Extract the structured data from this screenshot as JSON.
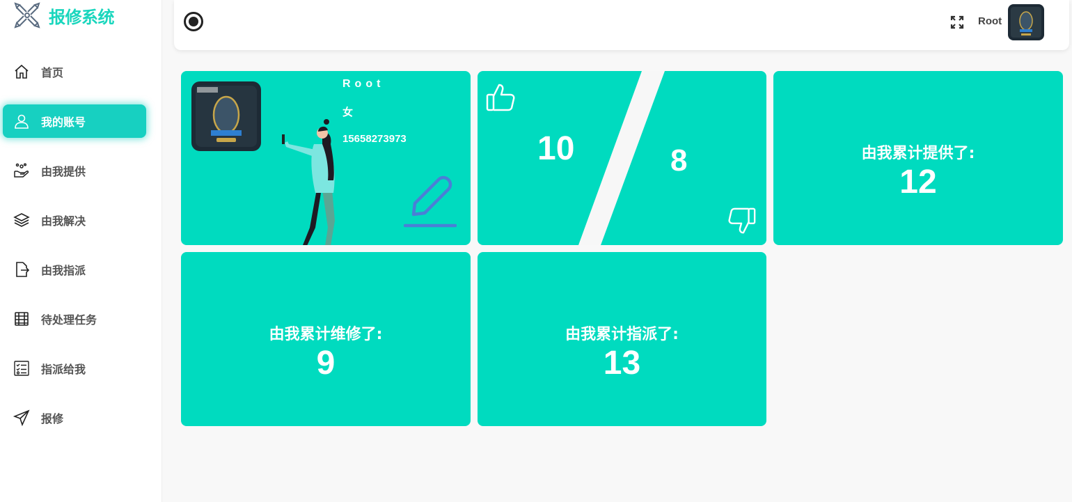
{
  "app": {
    "title": "报修系统"
  },
  "sidebar": {
    "items": [
      {
        "label": "首页",
        "icon": "home-icon"
      },
      {
        "label": "我的账号",
        "icon": "user-icon",
        "active": true
      },
      {
        "label": "由我提供",
        "icon": "hand-offer-icon"
      },
      {
        "label": "由我解决",
        "icon": "layers-icon"
      },
      {
        "label": "由我指派",
        "icon": "export-icon"
      },
      {
        "label": "待处理任务",
        "icon": "grid-icon"
      },
      {
        "label": "指派给我",
        "icon": "checklist-icon"
      },
      {
        "label": "报修",
        "icon": "send-icon"
      }
    ]
  },
  "header": {
    "username": "Root",
    "icons": [
      "toggle-icon",
      "fullscreen-icon",
      "avatar"
    ]
  },
  "profile": {
    "name": "Root",
    "gender": "女",
    "phone": "15658273973",
    "icons": [
      "edit-icon"
    ]
  },
  "rating": {
    "likes": "10",
    "dislikes": "8",
    "icons": [
      "thumbs-up-icon",
      "thumbs-down-icon"
    ]
  },
  "stats": {
    "provided": {
      "label": "由我累计提供了:",
      "value": "12"
    },
    "repaired": {
      "label": "由我累计维修了:",
      "value": "9"
    },
    "assigned": {
      "label": "由我累计指派了:",
      "value": "13"
    }
  },
  "colors": {
    "accent": "#00dbbf",
    "logo": "#19d6bd",
    "active_nav": "#17d0c1",
    "edit_icon": "#4a7fd6"
  }
}
